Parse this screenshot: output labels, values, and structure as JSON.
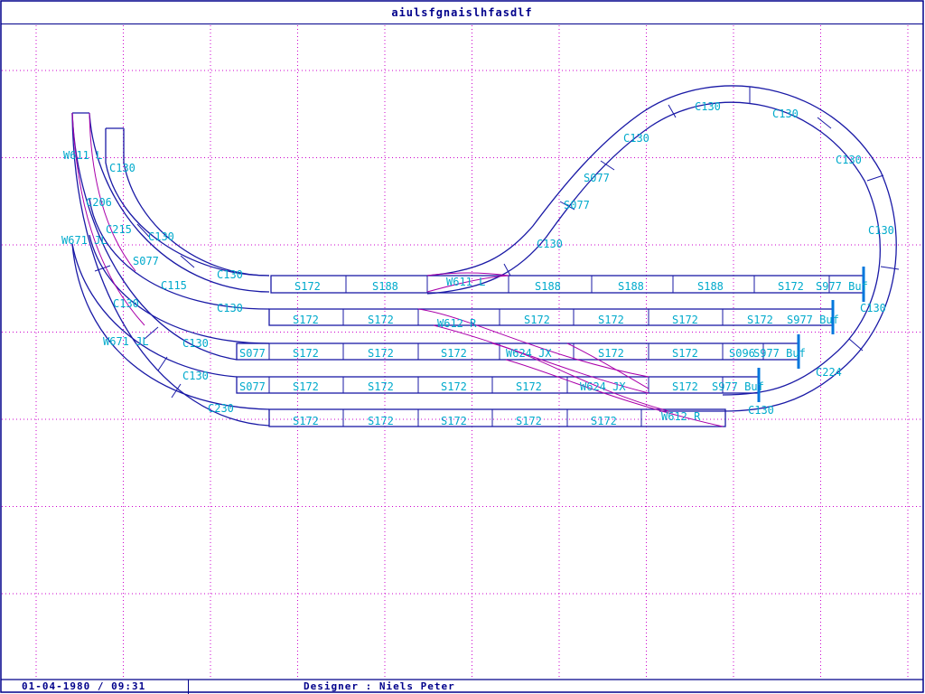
{
  "window": {
    "title": "aiulsfgnaislhfasdlf"
  },
  "status": {
    "datetime": "01-04-1980  /  09:31",
    "designer": "Designer : Niels Peter"
  },
  "colors": {
    "frame": "#00008b",
    "grid": "#cc00cc",
    "track": "#1a1aa6",
    "turnout": "#aa00aa",
    "label": "#00aacc",
    "buffer": "#0077dd"
  },
  "labels": [
    "W611 L",
    "C130",
    "C206",
    "C215",
    "C130",
    "W671 JL",
    "S077",
    "C115",
    "C130",
    "C130",
    "C130",
    "W671 JL",
    "C130",
    "C130",
    "C230",
    "S172",
    "S188",
    "W611 L",
    "S188",
    "S188",
    "S188",
    "S172",
    "S977 Buf",
    "S172",
    "S172",
    "W612 R",
    "S172",
    "S172",
    "S172",
    "S172",
    "S977 Buf",
    "S077",
    "S172",
    "S172",
    "S172",
    "W624 JX",
    "S172",
    "S172",
    "S096",
    "S977 Buf",
    "S077",
    "S172",
    "S172",
    "S172",
    "S172",
    "W624 JX",
    "S172",
    "S977 Buf",
    "S172",
    "S172",
    "S172",
    "S172",
    "S172",
    "W612 R",
    "C130",
    "S077",
    "S077",
    "C130",
    "C130",
    "C130",
    "C130",
    "C130",
    "C130",
    "C224",
    "C130"
  ]
}
